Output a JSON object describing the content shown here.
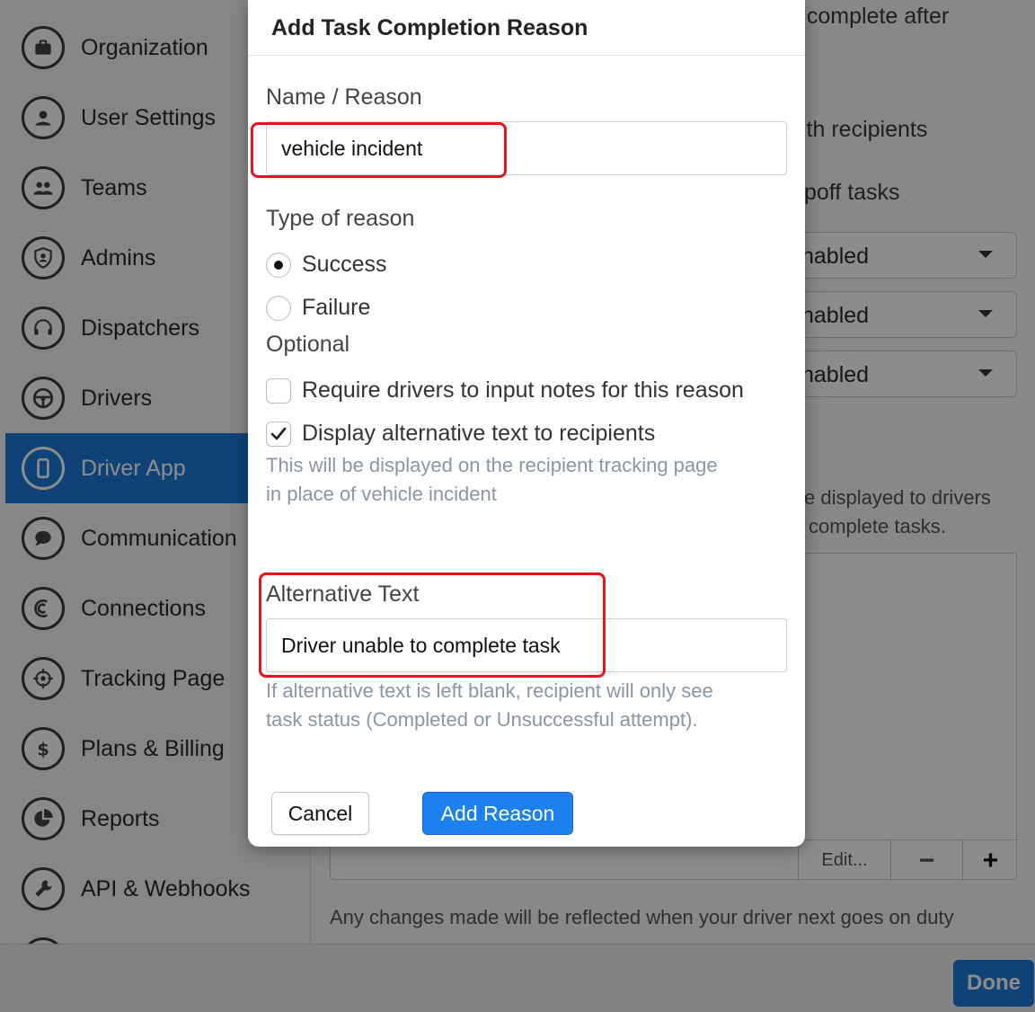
{
  "sidebar": {
    "items": [
      {
        "label": "Organization",
        "icon": "briefcase-icon"
      },
      {
        "label": "User Settings",
        "icon": "user-icon"
      },
      {
        "label": "Teams",
        "icon": "team-icon"
      },
      {
        "label": "Admins",
        "icon": "shield-user-icon"
      },
      {
        "label": "Dispatchers",
        "icon": "headset-icon"
      },
      {
        "label": "Drivers",
        "icon": "steering-wheel-icon"
      },
      {
        "label": "Driver App",
        "icon": "phone-icon",
        "active": true
      },
      {
        "label": "Communication",
        "icon": "chat-bubble-icon"
      },
      {
        "label": "Connections",
        "icon": "connections-icon"
      },
      {
        "label": "Tracking Page",
        "icon": "crosshair-icon"
      },
      {
        "label": "Plans & Billing",
        "icon": "dollar-icon"
      },
      {
        "label": "Reports",
        "icon": "pie-chart-icon"
      },
      {
        "label": "API & Webhooks",
        "icon": "wrench-icon"
      }
    ]
  },
  "background": {
    "text_complete_after": "e complete after",
    "text_with_recipients": "ith recipients",
    "text_dropoff_tasks": "poff tasks",
    "select_values": [
      "nabled",
      "nabled",
      "nabled"
    ],
    "text_displayed_drivers": "e displayed to drivers",
    "text_complete_tasks": "complete tasks.",
    "list_edit": "Edit...",
    "list_remove": "−",
    "list_add": "+",
    "footer_note": "Any changes made will be reflected when your driver next goes on duty",
    "done_label": "Done"
  },
  "modal": {
    "title": "Add Task Completion Reason",
    "name_label": "Name / Reason",
    "name_value": "vehicle incident",
    "type_label": "Type of reason",
    "type_options": [
      {
        "label": "Success",
        "selected": true
      },
      {
        "label": "Failure",
        "selected": false
      }
    ],
    "optional_label": "Optional",
    "require_notes_label": "Require drivers to input notes for this reason",
    "require_notes_checked": false,
    "display_alt_label": "Display alternative text to recipients",
    "display_alt_checked": true,
    "display_alt_help_1": "This will be displayed on the recipient tracking page",
    "display_alt_help_2": "in place of vehicle incident",
    "alt_text_label": "Alternative Text",
    "alt_text_value": "Driver unable to complete task",
    "alt_help_1": "If alternative text is left blank, recipient will only see",
    "alt_help_2": "task status (Completed or Unsuccessful attempt).",
    "cancel_label": "Cancel",
    "add_label": "Add Reason"
  },
  "colors": {
    "accent": "#1d80ef",
    "highlight": "#e5141c",
    "sidebar_active": "#1c7bd9"
  }
}
